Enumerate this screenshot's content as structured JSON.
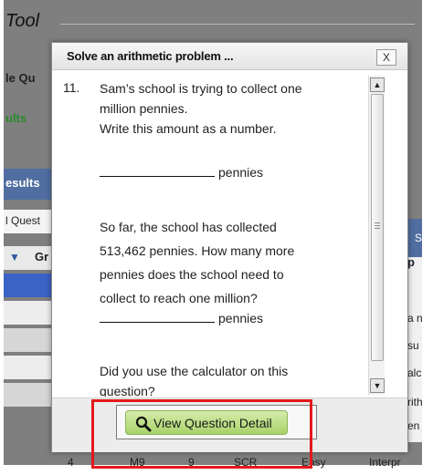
{
  "background": {
    "page_title": "Tool",
    "frag_quiz": "le Qu",
    "frag_results": "ults",
    "frag_results_tab": "esults",
    "frag_quest": "l Quest",
    "frag_gr": "Gr",
    "right_frags": [
      "S",
      "p",
      "a n",
      "su",
      "alc",
      "rith",
      "en"
    ],
    "bottom_row": [
      "4",
      "M9",
      "9",
      "SCR",
      "Easy",
      "Interpr"
    ]
  },
  "dialog": {
    "title": "Solve an arithmetic problem ...",
    "close_label": "X",
    "question_number": "11.",
    "lines": [
      "Sam’s school is trying to collect one",
      "million pennies.",
      "Write this amount as a number."
    ],
    "blank_suffix_1": "pennies",
    "lines2": [
      "So far, the school has collected",
      "513,462 pennies. How many more",
      "pennies does the school need to",
      "collect to reach one million?"
    ],
    "blank_suffix_2": "pennies",
    "lines3": [
      "Did you use the calculator on this",
      "question?"
    ],
    "button_label": "View Question Detail"
  },
  "colors": {
    "highlight": "#e3191c",
    "button_green": "#a8d36a",
    "header_blue": "#506ea0"
  }
}
